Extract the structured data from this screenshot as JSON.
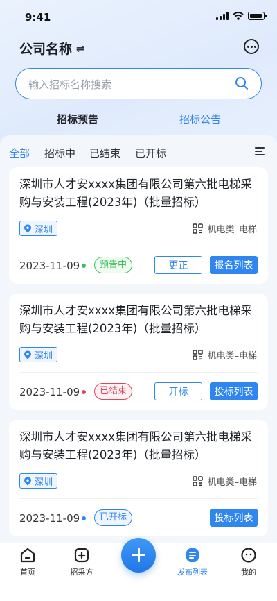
{
  "status_bar": {
    "time": "9:41"
  },
  "header": {
    "company": "公司名称",
    "switch_glyph": "⇌",
    "message_icon": "message-dots-icon"
  },
  "search": {
    "placeholder": "输入招标名称搜索"
  },
  "tabs": [
    {
      "label": "招标预告",
      "active": false
    },
    {
      "label": "招标公告",
      "active": true
    }
  ],
  "filters": [
    {
      "label": "全部",
      "active": true
    },
    {
      "label": "招标中",
      "active": false
    },
    {
      "label": "已结束",
      "active": false
    },
    {
      "label": "已开标",
      "active": false
    }
  ],
  "colors": {
    "accent": "#2f86f0",
    "green": "#3cbf5a",
    "red": "#d9485f"
  },
  "cards": [
    {
      "title": "深圳市人才安xxxx集团有限公司第六批电梯采购与安装工程(2023年)（批量招标）",
      "location": "深圳",
      "category": "机电类–电梯",
      "date": "2023-11-09",
      "status": "预告中",
      "status_color": "#3cbf5a",
      "secondary_button": "更正",
      "primary_button": "报名列表"
    },
    {
      "title": "深圳市人才安xxxx集团有限公司第六批电梯采购与安装工程(2023年)（批量招标）",
      "location": "深圳",
      "category": "机电类–电梯",
      "date": "2023-11-09",
      "status": "已结束",
      "status_color": "#d9485f",
      "secondary_button": "开标",
      "primary_button": "投标列表"
    },
    {
      "title": "深圳市人才安xxxx集团有限公司第六批电梯采购与安装工程(2023年)（批量招标）",
      "location": "深圳",
      "category": "机电类–电梯",
      "date": "2023-11-09",
      "status": "已开标",
      "status_color": "#2f86f0",
      "secondary_button": "",
      "primary_button": "投标列表"
    }
  ],
  "tabbar": [
    {
      "label": "首页",
      "icon": "home-icon"
    },
    {
      "label": "招采方",
      "icon": "plus-square-icon"
    },
    {
      "label": "发布列表",
      "icon": "list-doc-icon",
      "active": true
    },
    {
      "label": "我的",
      "icon": "profile-icon"
    }
  ]
}
